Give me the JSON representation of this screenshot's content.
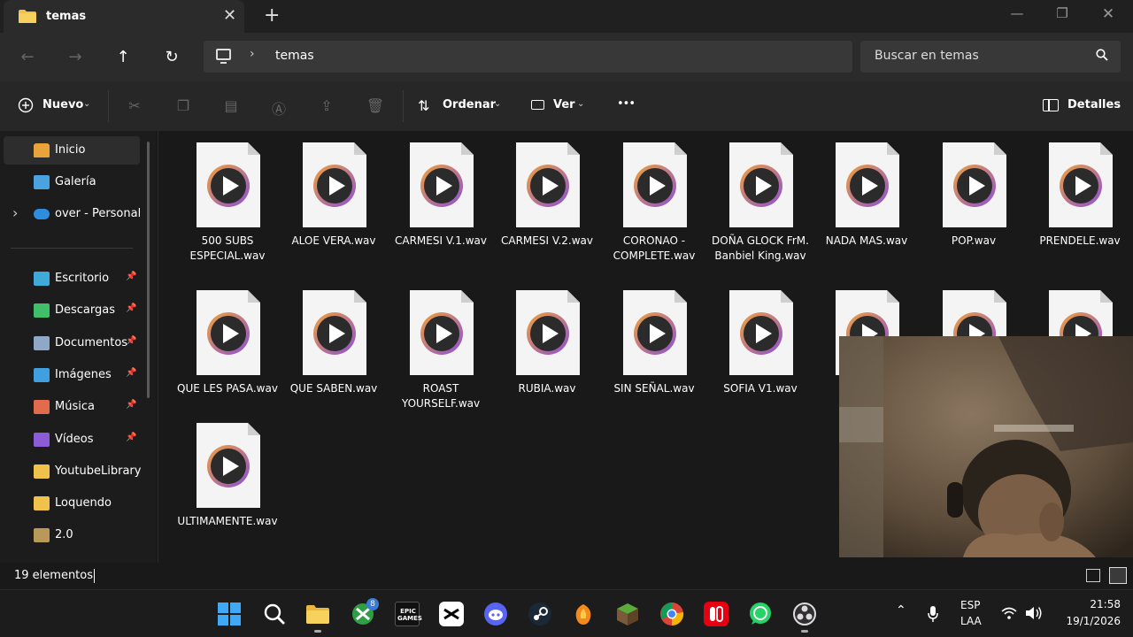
{
  "window": {
    "tab_title": "temas",
    "tab_close": "✕",
    "tab_add": "+",
    "minimize": "—",
    "restore": "❐",
    "close": "✕"
  },
  "nav": {
    "back": "←",
    "forward": "→",
    "up": "↑",
    "refresh": "↻",
    "chevron": "›",
    "breadcrumb": "temas",
    "search_placeholder": "Buscar en temas"
  },
  "toolbar": {
    "new_label": "Nuevo",
    "sort_label": "Ordenar",
    "view_label": "Ver",
    "more": "•••",
    "details_label": "Detalles"
  },
  "sidebar": {
    "items": [
      {
        "label": "Inicio",
        "icon": "home-icon",
        "color": "#e8a33a"
      },
      {
        "label": "Galería",
        "icon": "gallery-icon",
        "color": "#4aa3df"
      },
      {
        "label": "over - Personal",
        "icon": "onedrive-icon",
        "color": "#2d8ee0"
      },
      {
        "label": "Escritorio",
        "icon": "desktop-icon",
        "color": "#3fa9d8"
      },
      {
        "label": "Descargas",
        "icon": "download-icon",
        "color": "#3fbf6a"
      },
      {
        "label": "Documentos",
        "icon": "documents-icon",
        "color": "#8fa8c8"
      },
      {
        "label": "Imágenes",
        "icon": "pictures-icon",
        "color": "#3f9fdf"
      },
      {
        "label": "Música",
        "icon": "music-icon",
        "color": "#e36b4d"
      },
      {
        "label": "Vídeos",
        "icon": "videos-icon",
        "color": "#8b5cd6"
      },
      {
        "label": "YoutubeLibrary",
        "icon": "folder-icon",
        "color": "#f0c14b"
      },
      {
        "label": "Loquendo",
        "icon": "folder-icon",
        "color": "#f0c14b"
      },
      {
        "label": "2.0",
        "icon": "folder-icon",
        "color": "#b8995a"
      }
    ]
  },
  "files": [
    "500 SUBS ESPECIAL.wav",
    "ALOE VERA.wav",
    "CARMESI V.1.wav",
    "CARMESI V.2.wav",
    "CORONAO - COMPLETE.wav",
    "DOÑA GLOCK FrM. Banbiel King.wav",
    "NADA MAS.wav",
    "POP.wav",
    "PRENDELE.wav",
    "QUE LES PASA.wav",
    "QUE SABEN.wav",
    "ROAST YOURSELF.wav",
    "RUBIA.wav",
    "SIN SEÑAL.wav",
    "SOFIA V1.wav",
    "",
    "",
    "",
    "ULTIMAMENTE.wav"
  ],
  "status": {
    "count": "19 elementos"
  },
  "taskbar": {
    "lang_top": "ESP",
    "lang_bottom": "LAA",
    "time": "21:58",
    "date": "19/1/2026",
    "xbox_badge": "8",
    "epic_label": "EPIC\nGAMES"
  },
  "colors": {
    "accent": "#4cc2ff",
    "play_ring_start": "#f0a13a",
    "play_ring_end": "#8c4fd6"
  }
}
